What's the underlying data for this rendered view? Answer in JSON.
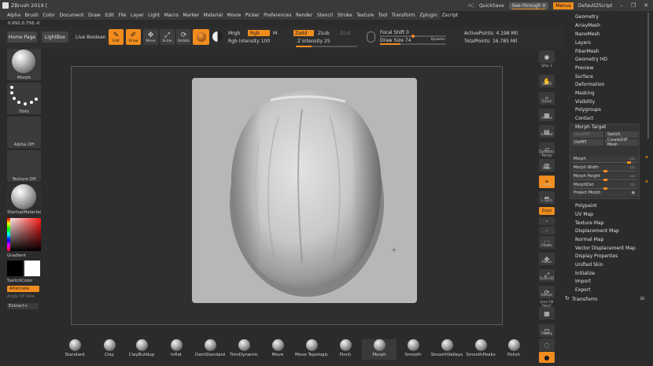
{
  "window": {
    "title": "ZBrush 2019 [",
    "quicksave": "QuickSave",
    "ac": "AC",
    "see_through": "See-through 0",
    "menus": "Menus",
    "script": "DefaultZScript",
    "controls": [
      "–",
      "❐",
      "✕"
    ]
  },
  "menubar": [
    "Alpha",
    "Brush",
    "Color",
    "Document",
    "Draw",
    "Edit",
    "File",
    "Layer",
    "Light",
    "Macro",
    "Marker",
    "Material",
    "Movie",
    "Picker",
    "Preferences",
    "Render",
    "Stencil",
    "Stroke",
    "Texture",
    "Tool",
    "Transform",
    "Zplugin",
    "Zscript"
  ],
  "coords": "0.692,0.758,-0",
  "topbar": {
    "home_page": "Home Page",
    "lightbox": "LightBox",
    "live_boolean": "Live Boolean",
    "edit": "Edit",
    "draw": "Draw",
    "move": "Move",
    "scale": "Scale",
    "rotate": "Rotate",
    "mrgb": "Mrgb",
    "rgb": "Rgb",
    "m": "M",
    "zadd": "Zadd",
    "zsub": "Zsub",
    "zcut": "Zcut",
    "rgb_intensity": "Rgb Intensity 100",
    "z_intensity": "Z Intensity 25",
    "focal_shift": "Focal Shift 0",
    "draw_size": "Draw Size 74",
    "dynamic": "Dynamic",
    "active_points": "ActivePoints: 4.198 Mil",
    "total_points": "TotalPoints: 16.785 Mil"
  },
  "leftshelf": {
    "morph": "Morph",
    "dots": "Dots",
    "alpha_off": "Alpha Off",
    "texture_off": "Texture Off",
    "startup_material": "StartupMaterial",
    "gradient": "Gradient",
    "switch_color": "SwitchColor",
    "alternate": "Alternate",
    "angle": "Angle Of View",
    "extract": "Extract+"
  },
  "rightshelf": {
    "labels": [
      "BPR",
      "SPix 3",
      "Scroll",
      "Zoom",
      "Actual",
      "AAHalf",
      "Dynamic Persp",
      "Floor",
      "Local",
      "L.Sym",
      "Gxyz",
      "",
      "Frame",
      "Move",
      "Scale3D",
      "Rotate",
      "Line Fill PolyF",
      "Transp",
      "Ghost",
      "Solo"
    ],
    "spix": "SPix 3"
  },
  "palette": {
    "items": [
      "Geometry",
      "ArrayMesh",
      "NanoMesh",
      "Layers",
      "FiberMesh",
      "Geometry HD",
      "Preview",
      "Surface",
      "Deformation",
      "Masking",
      "Visibility",
      "Polygroups",
      "Contact"
    ],
    "morph_target": {
      "title": "Morph Target",
      "storemt": "StoreMT",
      "switch": "Switch",
      "delmt": "DelMT",
      "create_diff": "CreateDiff Mesh",
      "sliders": [
        "Morph",
        "Morph Width",
        "Morph Height",
        "MorphDist",
        "Project Morph"
      ]
    },
    "items_after": [
      "Polypaint",
      "UV Map",
      "Texture Map",
      "Displacement Map",
      "Normal Map",
      "Vector Displacement Map",
      "Display Properties",
      "Unified Skin",
      "Initialize",
      "Import",
      "Export"
    ],
    "transform": "Transform"
  },
  "brushes": [
    "Standard",
    "Clay",
    "ClayBuildup",
    "Inflat",
    "DamStandard",
    "TrimDynamic",
    "Move",
    "Move Topologic",
    "Pinch",
    "Morph",
    "Smooth",
    "SmoothValleys",
    "SmoothPeaks",
    "Polish"
  ],
  "selected_brush": "Morph",
  "colors": {
    "accent": "#f18c1e",
    "bg": "#2b2b2b",
    "panel": "#3b3b3b"
  }
}
